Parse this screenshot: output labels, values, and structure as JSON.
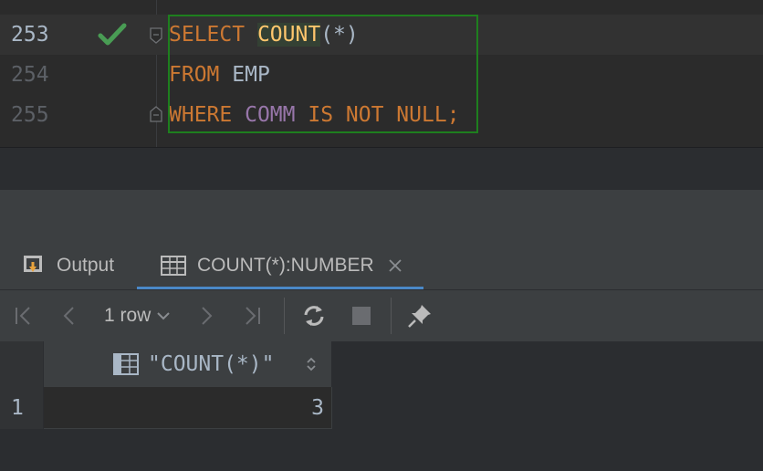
{
  "editor": {
    "lines": [
      {
        "number": "253",
        "tokens": {
          "kw1": "SELECT",
          "fn": "COUNT",
          "args": "(*)"
        }
      },
      {
        "number": "254",
        "tokens": {
          "kw1": "FROM",
          "table": "EMP"
        }
      },
      {
        "number": "255",
        "tokens": {
          "kw1": "WHERE",
          "col": "COMM",
          "kw2": "IS NOT NULL",
          "end": ";"
        }
      }
    ],
    "status_icon": "checkmark-icon"
  },
  "results": {
    "tabs": [
      {
        "label": "Output",
        "icon": "output-icon"
      },
      {
        "label": "COUNT(*):NUMBER",
        "icon": "table-icon",
        "active": true
      }
    ],
    "toolbar": {
      "rows_label": "1 row"
    },
    "grid": {
      "columns": [
        "\"COUNT(*)\""
      ],
      "rows": [
        {
          "num": "1",
          "cells": [
            "3"
          ]
        }
      ]
    }
  },
  "colors": {
    "keyword": "#cc7832",
    "function": "#ffc66d",
    "column": "#9876aa",
    "text": "#a9b7c6",
    "success": "#499c54",
    "active_tab": "#4a88c7"
  }
}
